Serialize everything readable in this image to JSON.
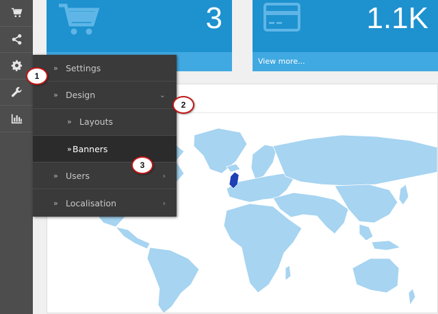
{
  "sidebar": {
    "icons": [
      "shopping-cart-icon",
      "share-icon",
      "gear-icon",
      "wrench-icon",
      "bar-chart-icon"
    ]
  },
  "tiles": [
    {
      "icon": "shopping-cart-icon",
      "value": "3",
      "footer": ""
    },
    {
      "icon": "credit-card-icon",
      "value": "1.1K",
      "footer": "View more..."
    }
  ],
  "flyout": {
    "items": [
      {
        "label": "Settings",
        "level": 0,
        "chevron": ""
      },
      {
        "label": "Design",
        "level": 0,
        "chevron": "down"
      },
      {
        "label": "Layouts",
        "level": 1,
        "chevron": ""
      },
      {
        "label": "Banners",
        "level": 1,
        "chevron": "",
        "active": true
      },
      {
        "label": "Users",
        "level": 0,
        "chevron": "right"
      },
      {
        "label": "Localisation",
        "level": 0,
        "chevron": "right"
      }
    ]
  },
  "markers": [
    "1",
    "2",
    "3"
  ],
  "colors": {
    "tile": "#1e91cf",
    "tile_footer": "#41a9e1",
    "sidebar": "#4d4d4d",
    "flyout": "#3a3a3a",
    "map_land": "#a6d4f1",
    "map_highlight": "#1f3fb6",
    "marker_border": "#c01818"
  }
}
